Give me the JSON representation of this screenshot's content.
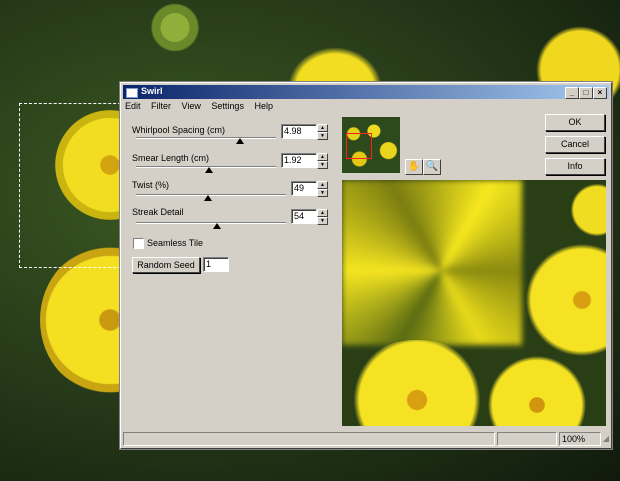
{
  "window": {
    "title": "Swirl",
    "buttons": [
      "_",
      "□",
      "×"
    ]
  },
  "menu": [
    "Edit",
    "Filter",
    "View",
    "Settings",
    "Help"
  ],
  "controls": {
    "whirlpool": {
      "label": "Whirlpool Spacing (cm)",
      "value": "4.98",
      "level": 0.74
    },
    "smear": {
      "label": "Smear Length (cm)",
      "value": "1.92",
      "level": 0.52
    },
    "twist": {
      "label": "Twist (%)",
      "value": "49",
      "level": 0.48
    },
    "streak": {
      "label": "Streak Detail",
      "value": "54",
      "level": 0.54
    },
    "seamless": {
      "label": "Seamless Tile",
      "checked": false
    },
    "random_seed": {
      "label": "Random Seed",
      "value": "1"
    }
  },
  "actions": {
    "ok": "OK",
    "cancel": "Cancel",
    "info": "Info"
  },
  "tools": {
    "hand": "hand-icon",
    "zoom": "zoom-icon"
  },
  "status": {
    "zoom": "100%"
  },
  "colors": {
    "title_start": "#0a246a",
    "title_end": "#a6caf0",
    "face": "#d4d0c8",
    "frame": "#ff2020"
  }
}
